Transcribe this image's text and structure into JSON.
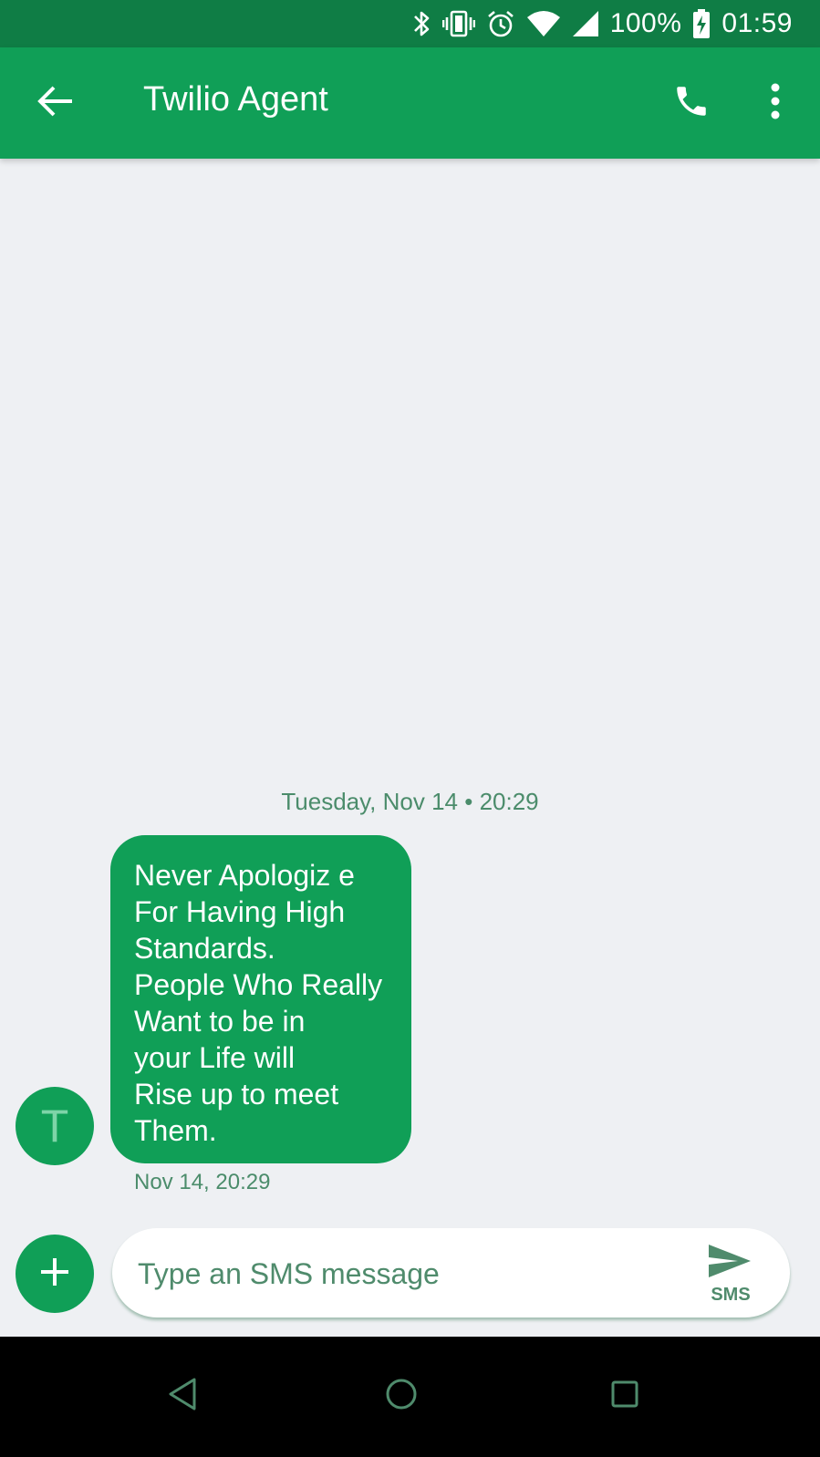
{
  "status_bar": {
    "battery": "100%",
    "time": "01:59",
    "icons": [
      "bluetooth-icon",
      "vibrate-icon",
      "alarm-icon",
      "wifi-icon",
      "signal-icon",
      "battery-charging-icon"
    ]
  },
  "app_bar": {
    "title": "Twilio Agent",
    "icons": [
      "back-arrow-icon",
      "phone-icon",
      "more-vert-icon"
    ]
  },
  "conversation": {
    "date_divider": "Tuesday, Nov 14 • 20:29",
    "messages": [
      {
        "sender_initial": "T",
        "text": "Never Apologiz e\nFor Having High\nStandards.\nPeople Who Really\nWant to be in\nyour Life will\nRise up to meet\nThem.",
        "time": "Nov 14, 20:29"
      }
    ]
  },
  "compose": {
    "placeholder": "Type an SMS message",
    "send_label": "SMS",
    "icons": [
      "add-icon",
      "send-icon"
    ]
  },
  "nav_bar": {
    "icons": [
      "nav-back-icon",
      "nav-home-icon",
      "nav-recents-icon"
    ]
  },
  "colors": {
    "status_bar": "#0f7d45",
    "app_bar": "#109f57",
    "background": "#eef0f3",
    "bubble": "#109f57",
    "meta_text": "#4b8c6b"
  }
}
